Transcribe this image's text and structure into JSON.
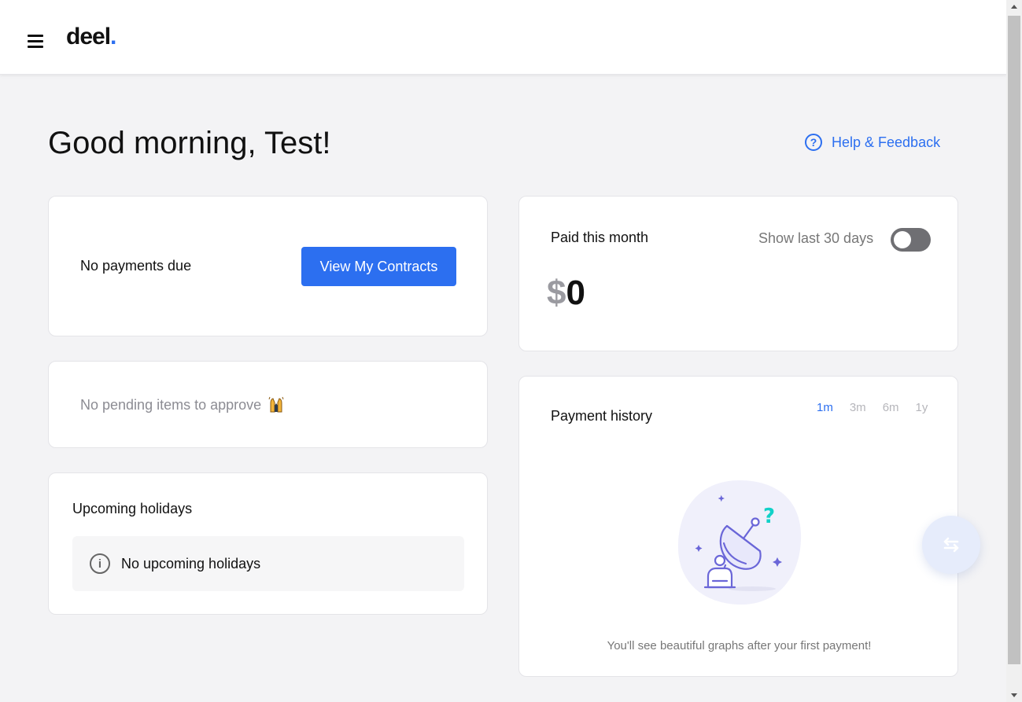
{
  "header": {
    "logo_text": "deel",
    "logo_dot": ".",
    "menu_icon": "hamburger-icon"
  },
  "greeting": "Good morning, Test!",
  "help": {
    "label": "Help & Feedback",
    "icon": "question-circle-icon",
    "icon_glyph": "?"
  },
  "payments_card": {
    "label": "No payments due",
    "button_label": "View My Contracts"
  },
  "pending_card": {
    "label": "No pending items to approve",
    "emoji_icon": "raising-hands-emoji-icon"
  },
  "holidays_card": {
    "title": "Upcoming holidays",
    "info_icon": "info-icon",
    "info_glyph": "i",
    "empty_text": "No upcoming holidays"
  },
  "paid_card": {
    "title": "Paid this month",
    "toggle_label": "Show last 30 days",
    "toggle_on": false,
    "currency": "$",
    "amount": "0"
  },
  "history_card": {
    "title": "Payment history",
    "ranges": [
      "1m",
      "3m",
      "6m",
      "1y"
    ],
    "active_range": "1m",
    "illustration": "satellite-dish-illustration",
    "empty_text": "You'll see beautiful graphs after your first payment!"
  },
  "fab": {
    "icon": "swap-arrows-icon"
  },
  "colors": {
    "brand_blue": "#2c6ff0",
    "background": "#f3f3f5",
    "card": "#ffffff"
  }
}
